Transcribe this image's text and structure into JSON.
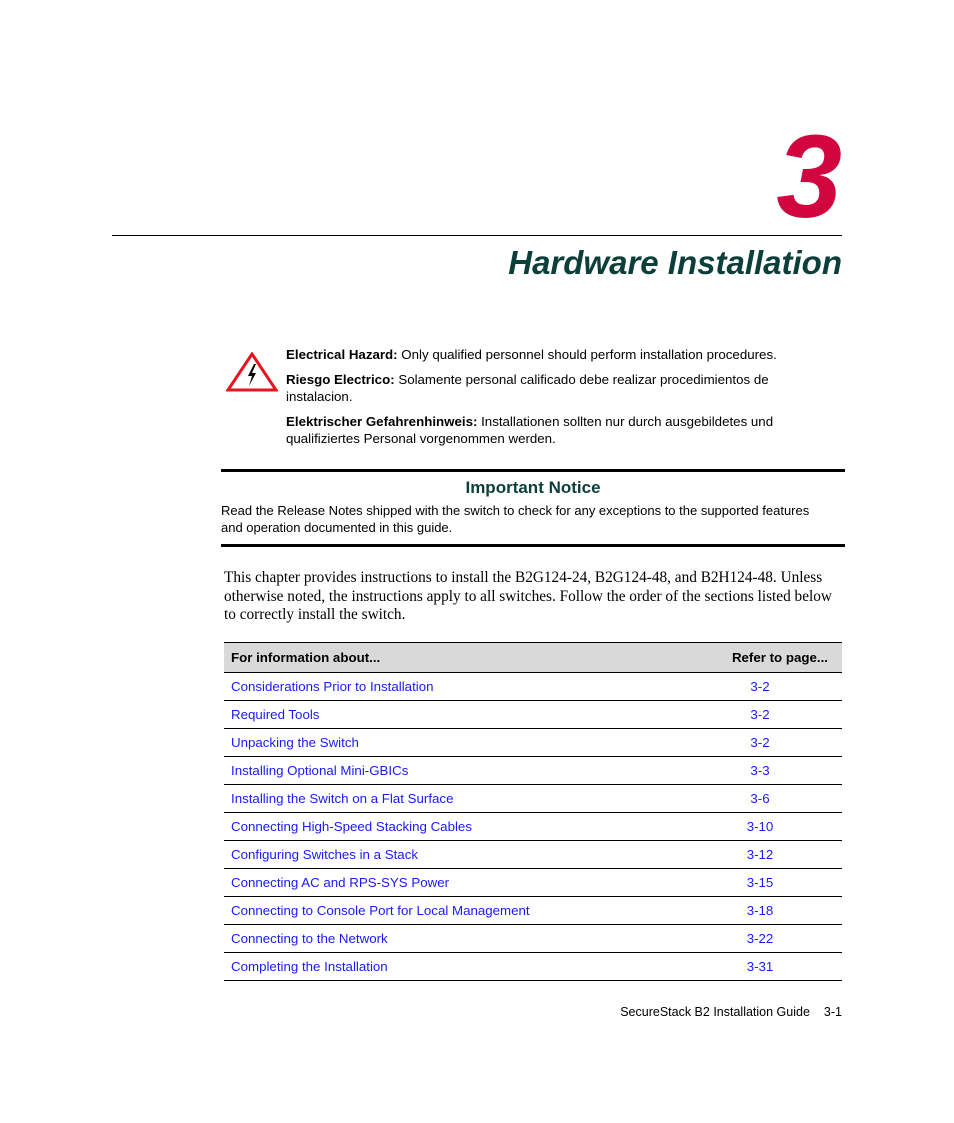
{
  "chapter": {
    "number": "3",
    "title": "Hardware Installation"
  },
  "hazard": {
    "icon": "electrical-hazard-icon",
    "colors": {
      "triangle": "#e8141b"
    },
    "items": [
      {
        "label": "Electrical Hazard:",
        "text": " Only qualified personnel should perform installation procedures."
      },
      {
        "label": "Riesgo Electrico:",
        "text": " Solamente personal calificado debe realizar procedimientos de instalacion."
      },
      {
        "label": "Elektrischer Gefahrenhinweis:",
        "text": " Installationen sollten nur durch ausgebildetes und qualifiziertes Personal vorgenommen werden."
      }
    ]
  },
  "notice": {
    "title": "Important Notice",
    "text": "Read the Release Notes shipped with the switch to check for any exceptions to the supported features and operation documented in this guide."
  },
  "intro": "This chapter provides instructions to install the B2G124-24, B2G124-48, and B2H124-48. Unless otherwise noted, the instructions apply to all switches. Follow the order of the sections listed below to correctly install the switch.",
  "toc": {
    "headers": [
      "For information about...",
      "Refer to page..."
    ],
    "rows": [
      {
        "topic": "Considerations Prior to Installation",
        "page": "3-2"
      },
      {
        "topic": "Required Tools",
        "page": "3-2"
      },
      {
        "topic": "Unpacking the Switch",
        "page": "3-2"
      },
      {
        "topic": "Installing Optional Mini-GBICs",
        "page": "3-3"
      },
      {
        "topic": "Installing the Switch on a Flat Surface",
        "page": "3-6"
      },
      {
        "topic": "Connecting High-Speed Stacking Cables",
        "page": "3-10"
      },
      {
        "topic": "Configuring Switches in a Stack",
        "page": "3-12"
      },
      {
        "topic": "Connecting AC and RPS-SYS Power",
        "page": "3-15"
      },
      {
        "topic": "Connecting to Console Port for Local Management",
        "page": "3-18"
      },
      {
        "topic": "Connecting to the Network",
        "page": "3-22"
      },
      {
        "topic": "Completing the Installation",
        "page": "3-31"
      }
    ]
  },
  "footer": {
    "guide": "SecureStack B2 Installation Guide",
    "page": "3-1"
  },
  "colors": {
    "chapter_number": "#d1063f",
    "title": "#0c3e3a",
    "link": "#1a1aff",
    "table_header_bg": "#d9d9d9"
  }
}
